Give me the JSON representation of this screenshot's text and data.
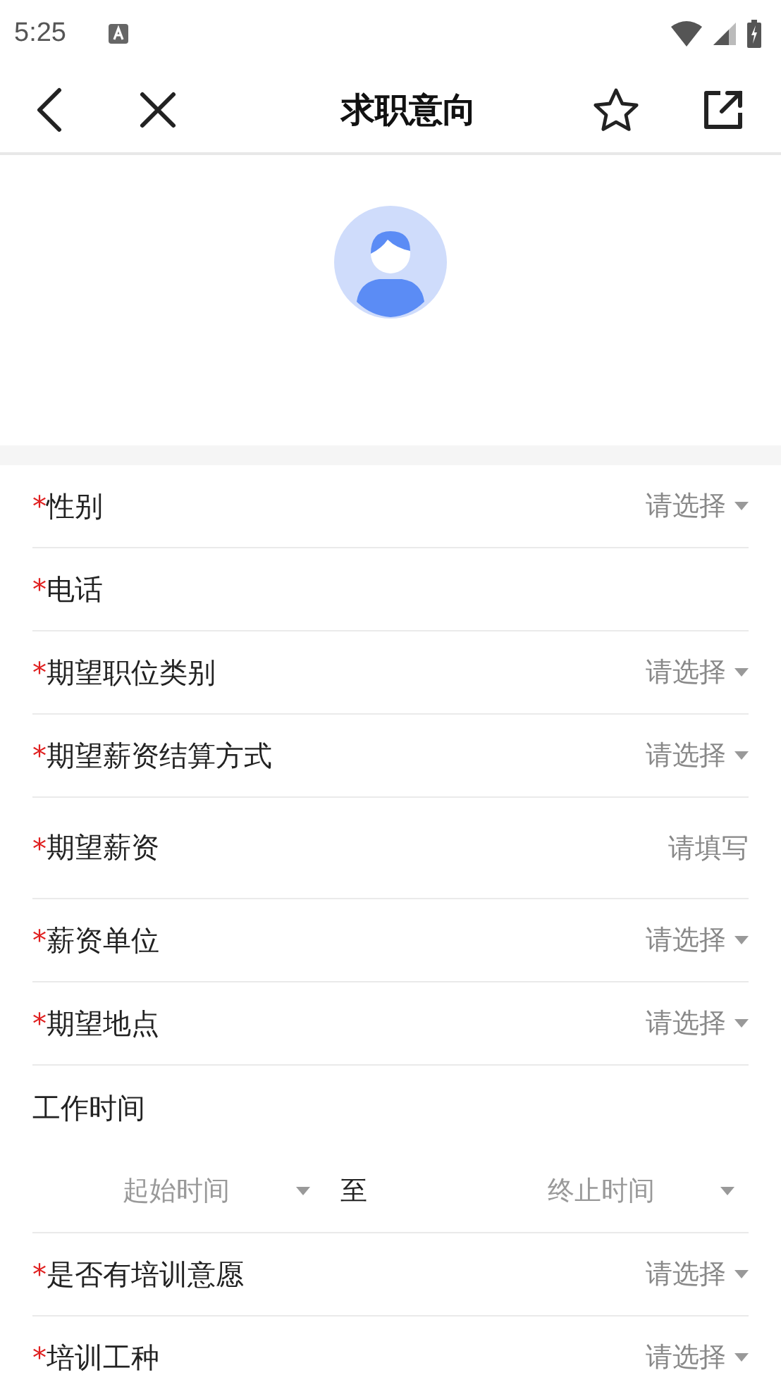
{
  "status_bar": {
    "time": "5:25"
  },
  "nav": {
    "title": "求职意向"
  },
  "fields": [
    {
      "kind": "select",
      "required_mark": "*",
      "label": "性别",
      "placeholder": "请选择"
    },
    {
      "kind": "input",
      "required_mark": "*",
      "label": "电话"
    },
    {
      "kind": "select",
      "required_mark": "*",
      "label": "期望职位类别",
      "placeholder": "请选择"
    },
    {
      "kind": "select",
      "required_mark": "*",
      "label": "期望薪资结算方式",
      "placeholder": "请选择"
    },
    {
      "kind": "input",
      "required_mark": "*",
      "label": "期望薪资",
      "placeholder": "请填写"
    },
    {
      "kind": "select",
      "required_mark": "*",
      "label": "薪资单位",
      "placeholder": "请选择"
    },
    {
      "kind": "select",
      "required_mark": "*",
      "label": "期望地点",
      "placeholder": "请选择"
    },
    {
      "kind": "range",
      "label": "工作时间",
      "start_placeholder": "起始时间",
      "separator": "至",
      "end_placeholder": "终止时间"
    },
    {
      "kind": "select",
      "required_mark": "*",
      "label": "是否有培训意愿",
      "placeholder": "请选择"
    },
    {
      "kind": "select",
      "required_mark": "*",
      "label": "培训工种",
      "placeholder": "请选择"
    }
  ]
}
